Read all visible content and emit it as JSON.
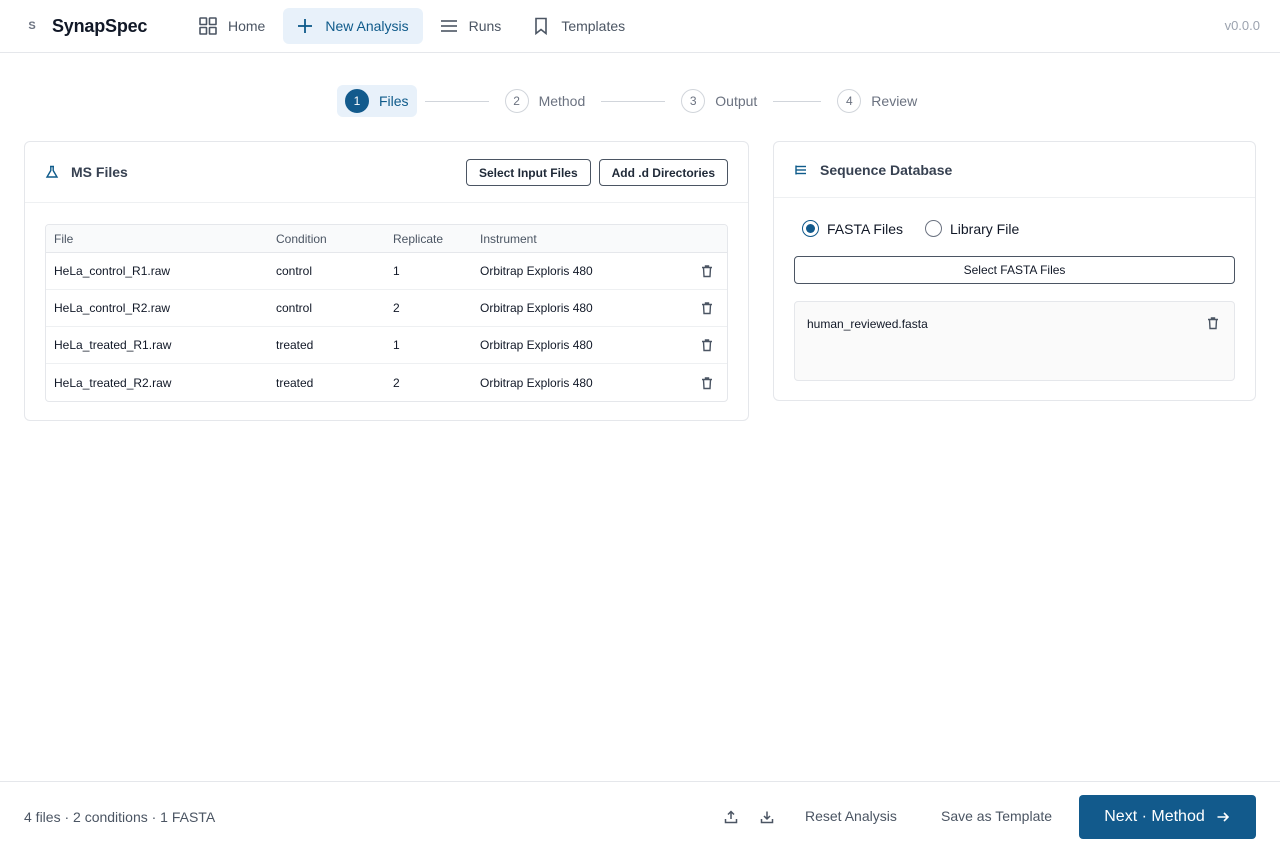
{
  "app": {
    "logo_mark": "S",
    "name": "SynapSpec",
    "version": "v0.0.0"
  },
  "nav": {
    "home": {
      "label": "Home",
      "icon": "grid-icon"
    },
    "new_analysis": {
      "label": "New Analysis",
      "icon": "plus-icon",
      "active": true
    },
    "runs": {
      "label": "Runs",
      "icon": "list-icon"
    },
    "templates": {
      "label": "Templates",
      "icon": "bookmark-icon"
    }
  },
  "stepper": [
    {
      "num": "1",
      "label": "Files",
      "active": true
    },
    {
      "num": "2",
      "label": "Method"
    },
    {
      "num": "3",
      "label": "Output"
    },
    {
      "num": "4",
      "label": "Review"
    }
  ],
  "ms_files": {
    "title": "MS Files",
    "select_input_label": "Select Input Files",
    "add_dirs_label": "Add .d Directories",
    "columns": {
      "file": "File",
      "condition": "Condition",
      "replicate": "Replicate",
      "instrument": "Instrument"
    },
    "rows": [
      {
        "file": "HeLa_control_R1.raw",
        "condition": "control",
        "replicate": "1",
        "instrument": "Orbitrap Exploris 480"
      },
      {
        "file": "HeLa_control_R2.raw",
        "condition": "control",
        "replicate": "2",
        "instrument": "Orbitrap Exploris 480"
      },
      {
        "file": "HeLa_treated_R1.raw",
        "condition": "treated",
        "replicate": "1",
        "instrument": "Orbitrap Exploris 480"
      },
      {
        "file": "HeLa_treated_R2.raw",
        "condition": "treated",
        "replicate": "2",
        "instrument": "Orbitrap Exploris 480"
      }
    ]
  },
  "sequence_db": {
    "title": "Sequence Database",
    "radio_fasta": "FASTA Files",
    "radio_library": "Library File",
    "selected": "fasta",
    "select_fasta_label": "Select FASTA Files",
    "fasta_files": [
      "human_reviewed.fasta"
    ]
  },
  "footer": {
    "summary": "4 files · 2 conditions · 1 FASTA",
    "reset_label": "Reset Analysis",
    "save_template_label": "Save as Template",
    "next_label": "Next · Method"
  },
  "colors": {
    "primary": "#125a8c",
    "active_bg": "#e8f1fa"
  }
}
